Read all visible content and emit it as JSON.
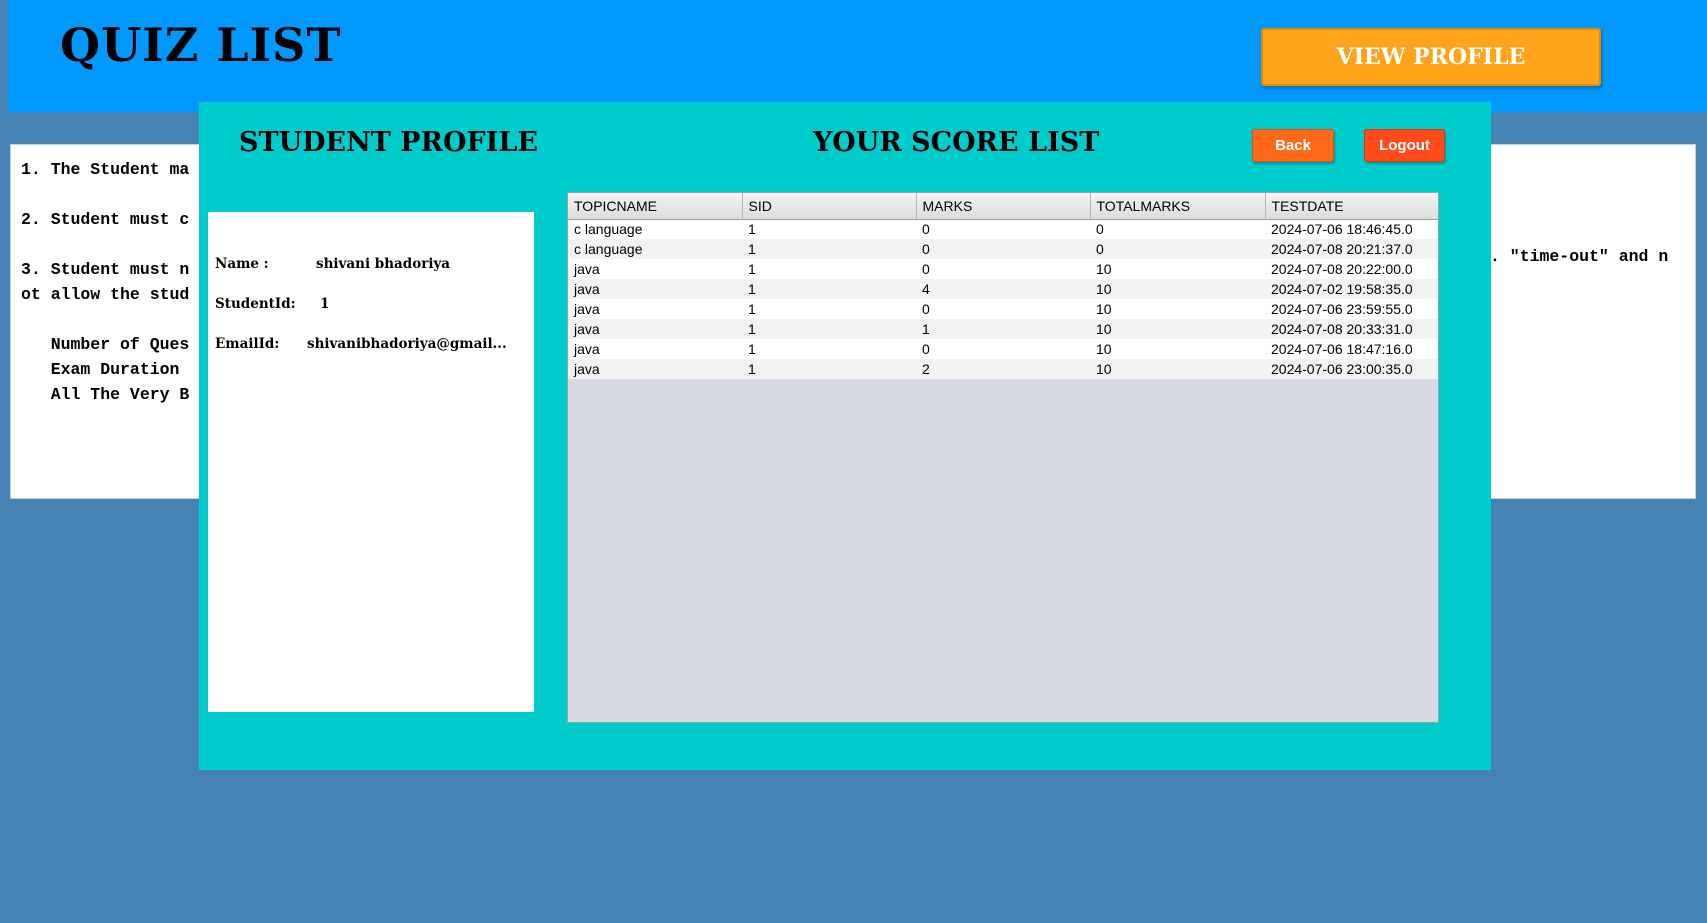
{
  "header": {
    "title": "QUIZ LIST",
    "view_profile_label": "VIEW PROFILE"
  },
  "instructions": {
    "lines": [
      "1. The Student ma",
      "",
      "2. Student must c",
      "",
      "3. Student must n",
      "ot allow the stud",
      "",
      "   Number of Ques",
      "   Exam Duration ",
      "   All The Very B"
    ],
    "right_fragment": ". \"time-out\" and n"
  },
  "dialog": {
    "profile_title": "STUDENT PROFILE",
    "score_title": "YOUR SCORE LIST",
    "back_label": "Back",
    "logout_label": "Logout",
    "profile": {
      "name_label": "Name :",
      "name_value": "shivani bhadoriya",
      "id_label": "StudentId:",
      "id_value": "1",
      "email_label": "EmailId:",
      "email_value": "shivanibhadoriya@gmail..."
    },
    "table": {
      "columns": [
        "TOPICNAME",
        "SID",
        "MARKS",
        "TOTALMARKS",
        "TESTDATE"
      ],
      "rows": [
        [
          "c language",
          "1",
          "0",
          "0",
          "2024-07-06 18:46:45.0"
        ],
        [
          "c language",
          "1",
          "0",
          "0",
          "2024-07-08 20:21:37.0"
        ],
        [
          "java",
          "1",
          "0",
          "10",
          "2024-07-08 20:22:00.0"
        ],
        [
          "java",
          "1",
          "4",
          "10",
          "2024-07-02 19:58:35.0"
        ],
        [
          "java",
          "1",
          "0",
          "10",
          "2024-07-06 23:59:55.0"
        ],
        [
          "java",
          "1",
          "1",
          "10",
          "2024-07-08 20:33:31.0"
        ],
        [
          "java",
          "1",
          "0",
          "10",
          "2024-07-06 18:47:16.0"
        ],
        [
          "java",
          "1",
          "2",
          "10",
          "2024-07-06 23:00:35.0"
        ]
      ]
    }
  }
}
